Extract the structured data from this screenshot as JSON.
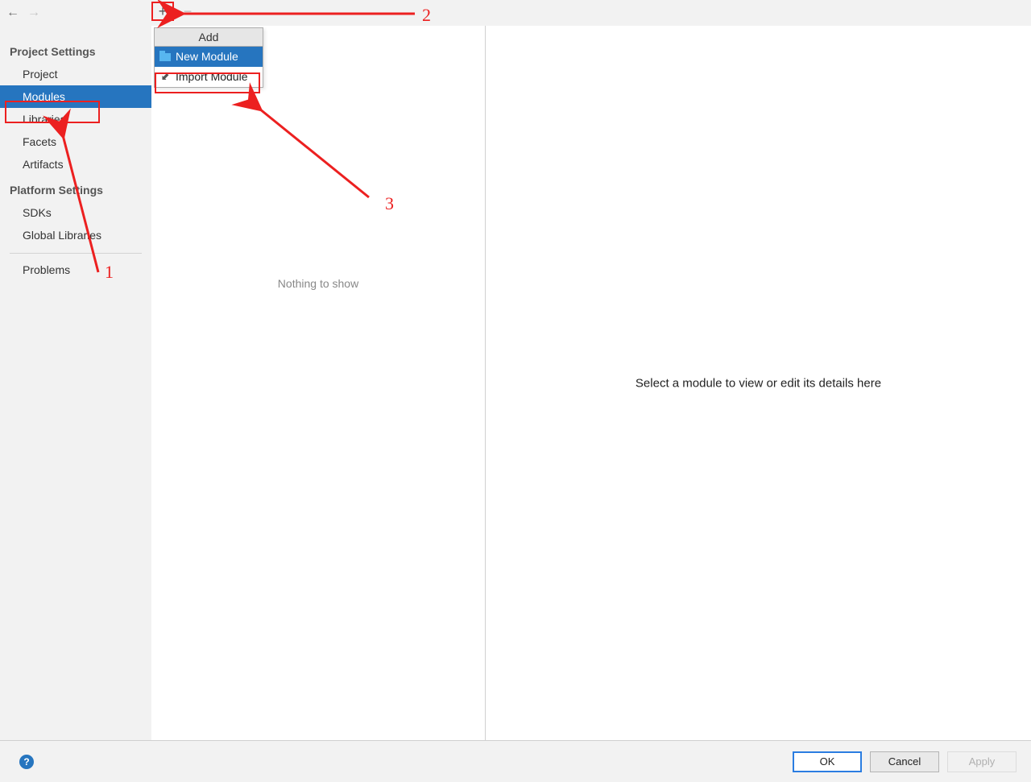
{
  "sidebar": {
    "project_settings_label": "Project Settings",
    "platform_settings_label": "Platform Settings",
    "items": {
      "project": "Project",
      "modules": "Modules",
      "libraries": "Libraries",
      "facets": "Facets",
      "artifacts": "Artifacts",
      "sdks": "SDKs",
      "global_libraries": "Global Libraries",
      "problems": "Problems"
    }
  },
  "popup": {
    "header": "Add",
    "new_module": "New Module",
    "import_module": "Import Module"
  },
  "middle": {
    "empty_text": "Nothing to show"
  },
  "detail": {
    "placeholder": "Select a module to view or edit its details here"
  },
  "buttons": {
    "ok": "OK",
    "cancel": "Cancel",
    "apply": "Apply"
  },
  "annotations": {
    "n1": "1",
    "n2": "2",
    "n3": "3"
  }
}
